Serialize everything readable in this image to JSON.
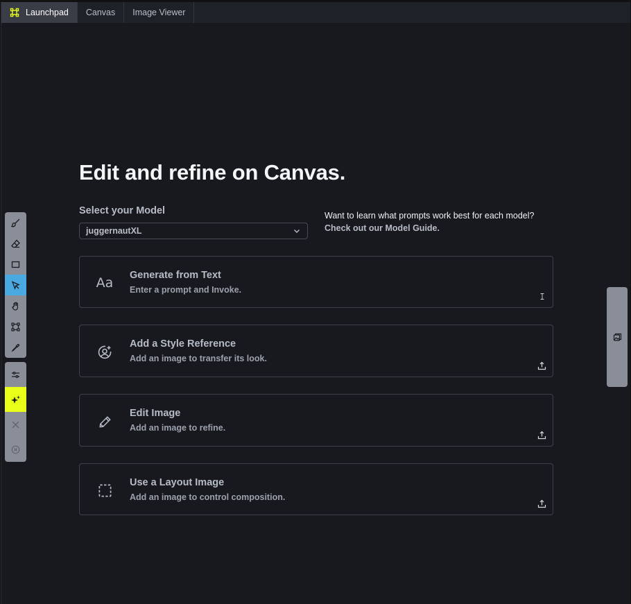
{
  "tabs": [
    {
      "label": "Launchpad",
      "active": true,
      "icon": "bounding-box-icon"
    },
    {
      "label": "Canvas",
      "active": false
    },
    {
      "label": "Image Viewer",
      "active": false
    }
  ],
  "toolbar": {
    "tools": [
      "brush-icon",
      "eraser-icon",
      "rectangle-icon",
      "move-cursor-icon",
      "hand-icon",
      "transform-icon",
      "color-picker-icon"
    ],
    "selected": "move-cursor-icon",
    "secondary": [
      "settings-sliders-icon",
      "sparkle-icon",
      "close-icon",
      "cancel-circle-icon"
    ]
  },
  "main": {
    "title": "Edit and refine on Canvas.",
    "model_label": "Select your Model",
    "model_value": "juggernautXL",
    "guide_question": "Want to learn what prompts work best for each model?",
    "guide_link": "Check out our Model Guide."
  },
  "cards": [
    {
      "title": "Generate from Text",
      "desc": "Enter a prompt and Invoke.",
      "icon": "text-aa-icon",
      "corner": "text-cursor-icon"
    },
    {
      "title": "Add a Style Reference",
      "desc": "Add an image to transfer its look.",
      "icon": "user-circle-plus-icon",
      "corner": "upload-icon"
    },
    {
      "title": "Edit Image",
      "desc": "Add an image to refine.",
      "icon": "pencil-icon",
      "corner": "upload-icon"
    },
    {
      "title": "Use a Layout Image",
      "desc": "Add an image to control composition.",
      "icon": "dashed-square-icon",
      "corner": "upload-icon"
    }
  ],
  "colors": {
    "accent_selected": "#4aa9e0",
    "accent_yellow": "#e8ff1a",
    "background": "#18191e"
  }
}
